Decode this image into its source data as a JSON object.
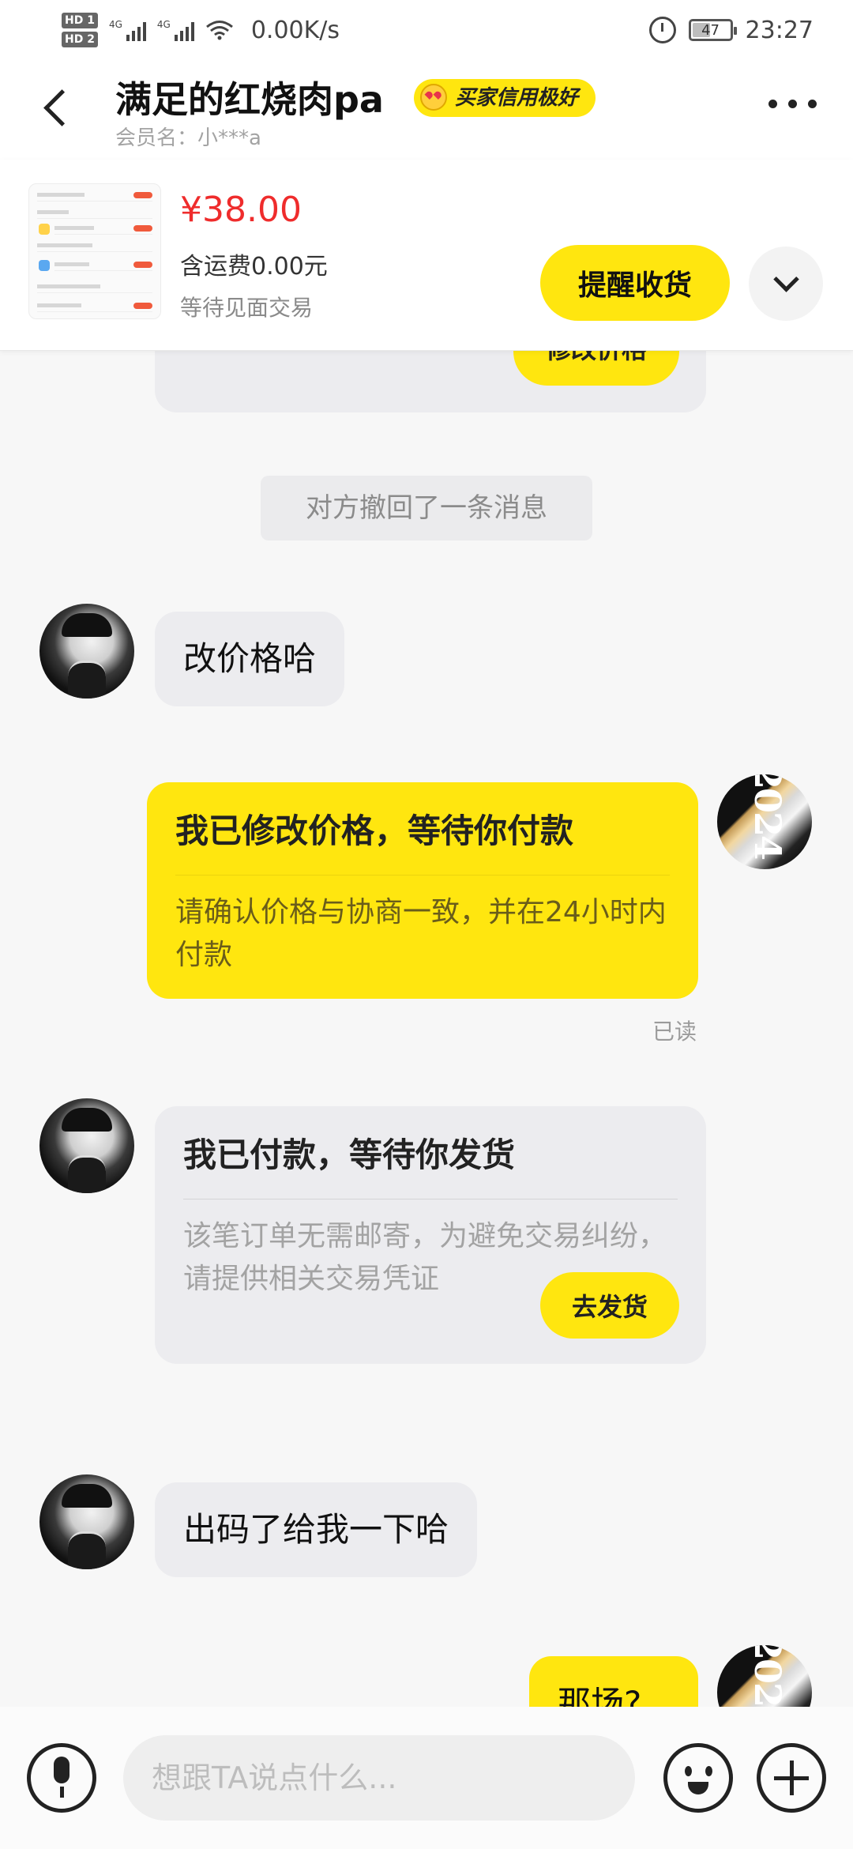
{
  "status_bar": {
    "hd1": "HD 1",
    "hd2": "HD 2",
    "net1": "4G",
    "net2": "4G",
    "speed": "0.00K/s",
    "battery": "47",
    "time": "23:27"
  },
  "header": {
    "title": "满足的红烧肉pa",
    "badge": "买家信用极好",
    "member": "会员名：小***a"
  },
  "product": {
    "price": "¥38.00",
    "shipping": "含运费0.00元",
    "status": "等待见面交易",
    "remind_label": "提醒收货"
  },
  "messages": {
    "partial_button": "修改价格",
    "system": "对方撤回了一条消息",
    "m1": "改价格哈",
    "m2": {
      "title": "我已修改价格，等待你付款",
      "body": "请确认价格与协商一致，并在24小时内付款"
    },
    "read_label": "已读",
    "m3": {
      "title": "我已付款，等待你发货",
      "body": "该笔订单无需邮寄，为避免交易纠纷，请提供相关交易凭证",
      "button": "去发货"
    },
    "m4": "出码了给我一下哈",
    "m5": "那场?"
  },
  "input": {
    "placeholder": "想跟TA说点什么..."
  },
  "colors": {
    "accent": "#ffe60f",
    "price": "#ef2c2c"
  }
}
